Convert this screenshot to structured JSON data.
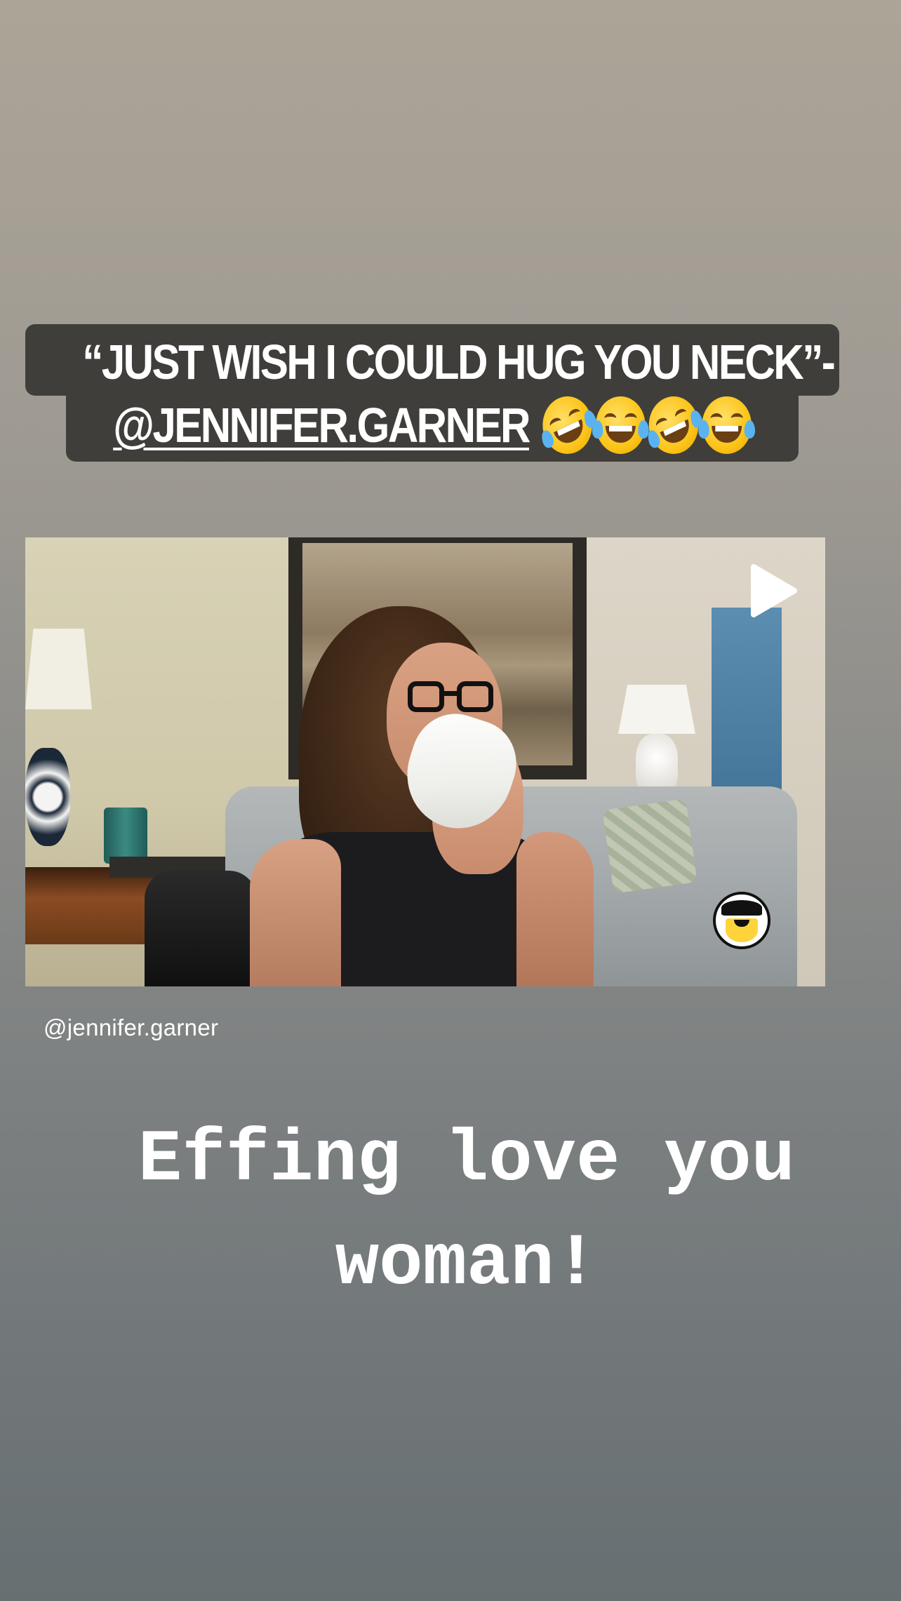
{
  "caption": {
    "line1": "“JUST WISH I COULD HUG YOU NECK”-",
    "line2_mention": "@JENNIFER.GARNER",
    "emojis": [
      "rolling-on-floor-laughing",
      "face-with-tears-of-joy",
      "rolling-on-floor-laughing",
      "face-with-tears-of-joy"
    ]
  },
  "video": {
    "play_icon": "play-icon",
    "mascot_icon": "viking-mascot-icon",
    "attribution": "@jennifer.garner"
  },
  "story_text": {
    "line1": "Effing love you",
    "line2": "woman!"
  },
  "colors": {
    "caption_bg": "#3f3e3a",
    "text": "#ffffff"
  }
}
